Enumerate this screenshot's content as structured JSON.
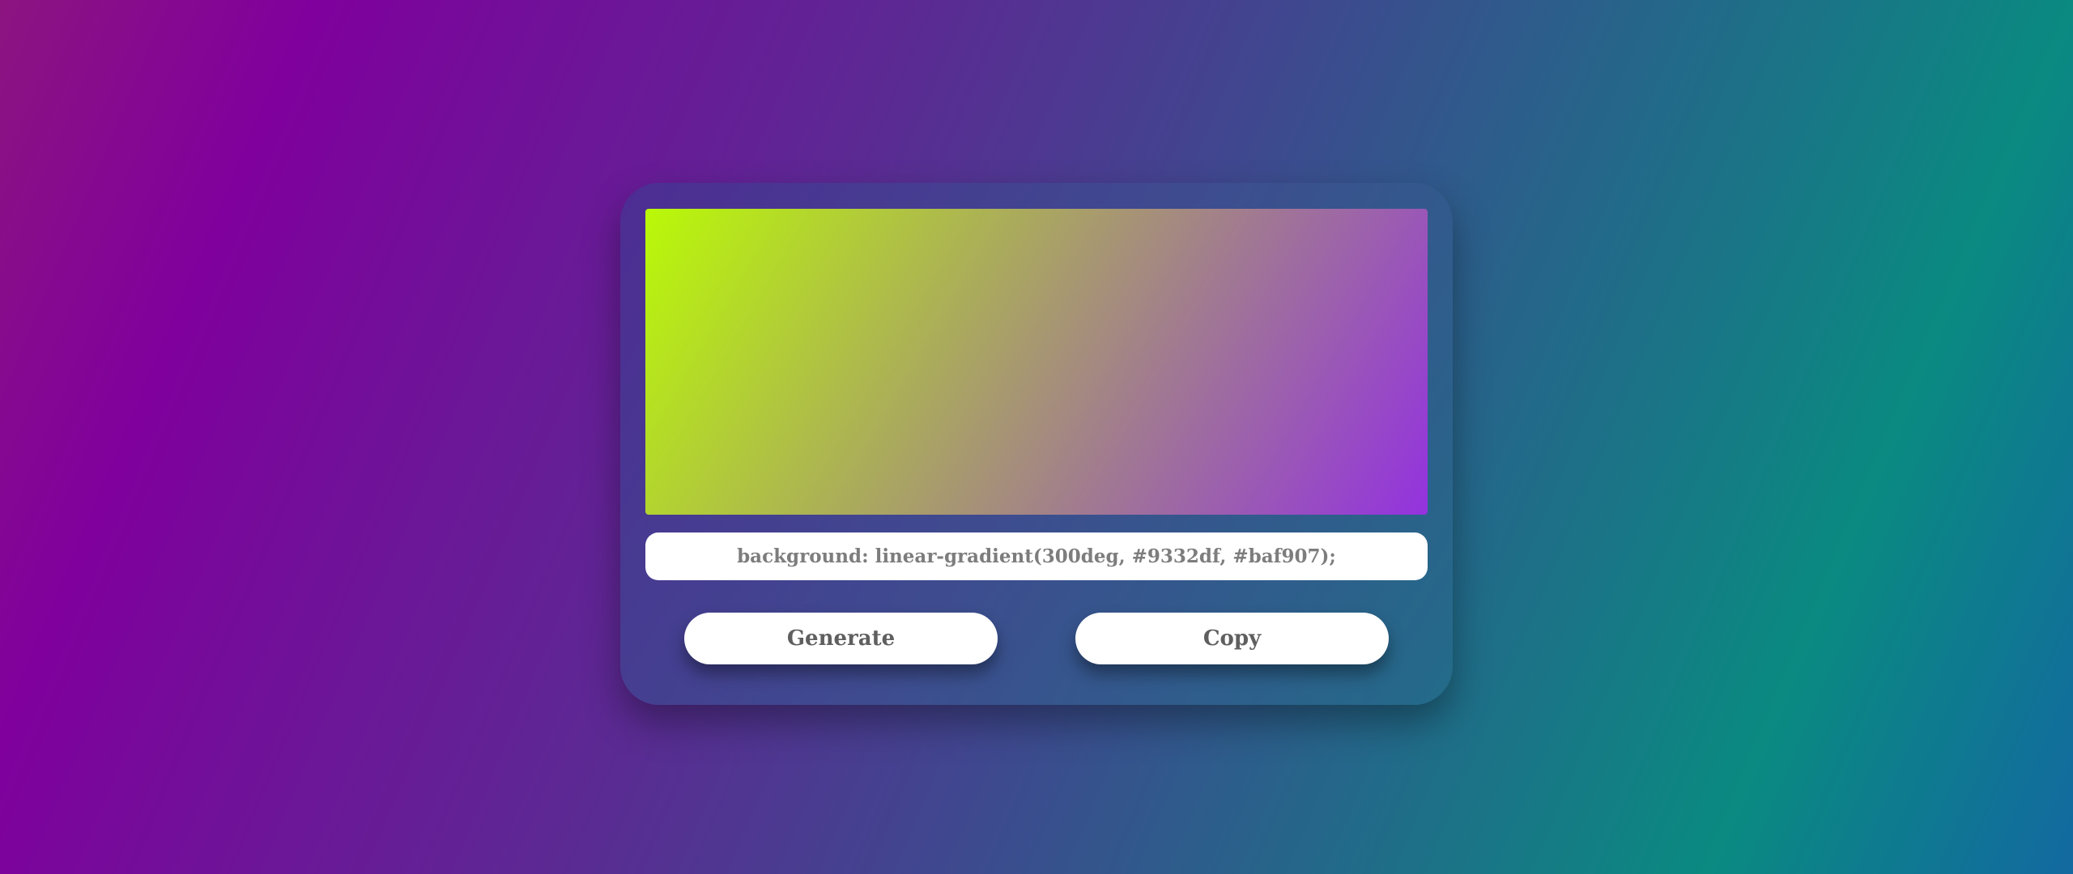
{
  "theme": {
    "page_gradient": [
      "#8c0fa0",
      "#7f009d",
      "#5f2c93",
      "#3e4a8e",
      "#226b8a",
      "#0a8a82",
      "#118079",
      "#136c99"
    ],
    "card_gradient": [
      "#4c2f92",
      "#3f4a90",
      "#266a88"
    ],
    "button_text_color": "#5f5f5f",
    "code_text_color": "#7d7d7d"
  },
  "gradient": {
    "angle": 300,
    "color_start": "#9332df",
    "color_end": "#baf907"
  },
  "code_field": {
    "value": "background: linear-gradient(300deg, #9332df, #baf907);"
  },
  "buttons": {
    "generate_label": "Generate",
    "copy_label": "Copy"
  }
}
